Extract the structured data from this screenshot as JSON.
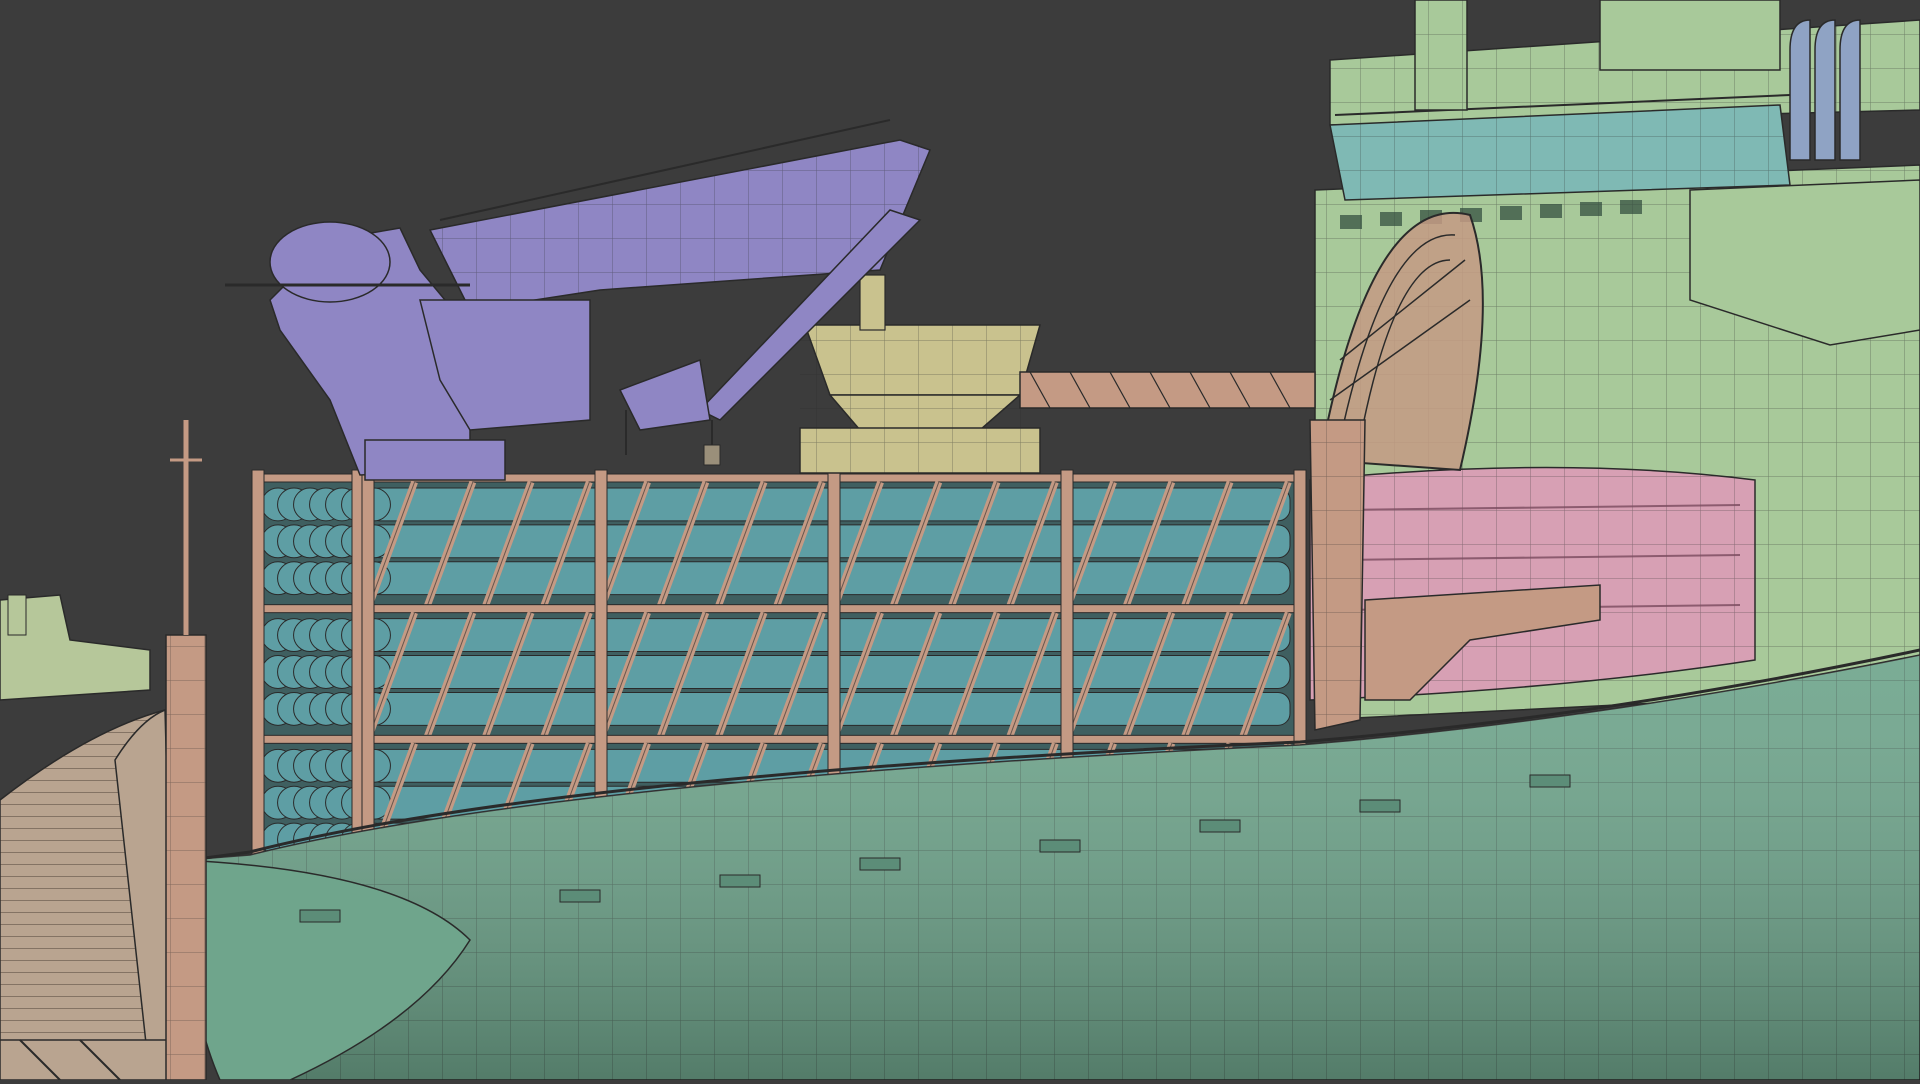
{
  "scene": {
    "background_color": "#3c3c3c",
    "render_style": "wireframe-over-shaded 3D model viewport",
    "wire_color": "#2a2a2a"
  },
  "objects": {
    "hull": {
      "label": "",
      "color": "#6fa58c"
    },
    "superstructure": {
      "label": "",
      "color": "#a8c99a"
    },
    "bridge_deck": {
      "label": "",
      "color": "#7fb9b4"
    },
    "crane": {
      "label": "",
      "color": "#8f86c4"
    },
    "pipe_racks": {
      "label": "",
      "color": "#c49a84",
      "pipe_color": "#5e9ea4",
      "levels": 3,
      "bays": 4
    },
    "reel_tower": {
      "label": "",
      "color": "#c49a84"
    },
    "carousel": {
      "label": "",
      "color": "#d7a0b4"
    },
    "hopper": {
      "label": "",
      "color": "#c9c28e"
    },
    "exhaust_stack": {
      "label": "",
      "color": "#a8c99a"
    },
    "pier": {
      "label": "",
      "color": "#b9a490"
    },
    "mast": {
      "label": "",
      "color": "#c49a84"
    }
  }
}
